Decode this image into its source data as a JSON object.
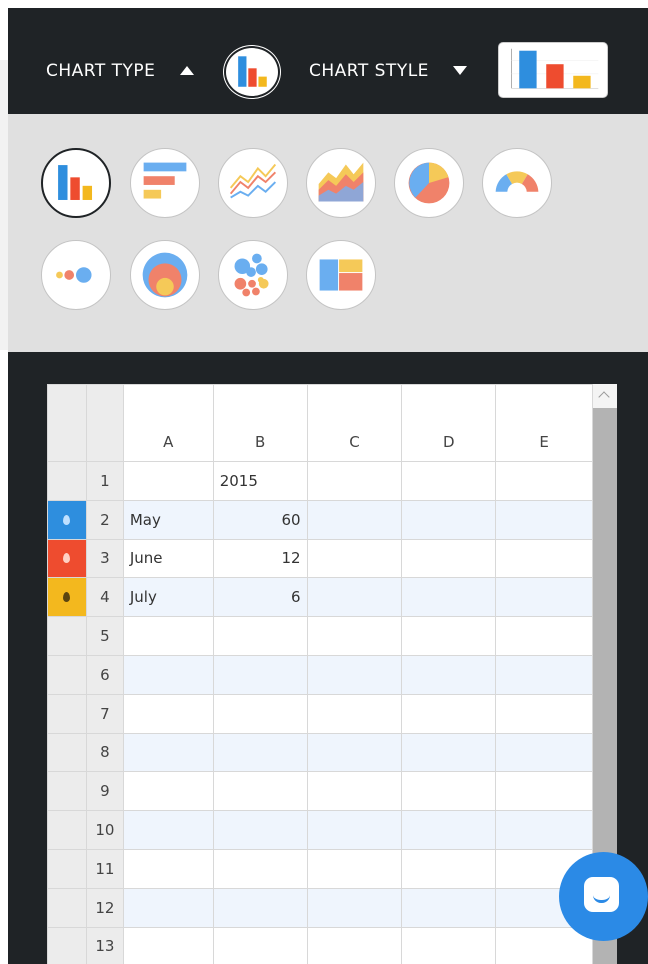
{
  "toolbar": {
    "chart_type_label": "CHART TYPE",
    "chart_style_label": "CHART STYLE",
    "chart_type_state": "expanded",
    "chart_style_state": "collapsed"
  },
  "chart_types": [
    {
      "name": "column-chart",
      "selected": true
    },
    {
      "name": "bar-chart",
      "selected": false
    },
    {
      "name": "line-chart",
      "selected": false
    },
    {
      "name": "area-chart",
      "selected": false
    },
    {
      "name": "pie-chart",
      "selected": false
    },
    {
      "name": "gauge-chart",
      "selected": false
    },
    {
      "name": "dot-chart",
      "selected": false
    },
    {
      "name": "nested-circles-chart",
      "selected": false
    },
    {
      "name": "bubble-chart",
      "selected": false
    },
    {
      "name": "treemap-chart",
      "selected": false
    }
  ],
  "colors": {
    "blue": "#2e8ede",
    "red": "#ee4c2f",
    "yellow": "#f3b81e",
    "dark_bg": "#1f2326",
    "panel_bg": "#e0e0e0",
    "chat": "#2b8ae6"
  },
  "grid": {
    "columns": [
      "A",
      "B",
      "C",
      "D",
      "E"
    ],
    "rows": [
      {
        "num": "1",
        "swatch": "",
        "A": "",
        "B": "2015",
        "C": "",
        "D": "",
        "E": ""
      },
      {
        "num": "2",
        "swatch": "blue",
        "A": "May",
        "B": "60",
        "C": "",
        "D": "",
        "E": ""
      },
      {
        "num": "3",
        "swatch": "red",
        "A": "June",
        "B": "12",
        "C": "",
        "D": "",
        "E": ""
      },
      {
        "num": "4",
        "swatch": "yellow",
        "A": "July",
        "B": "6",
        "C": "",
        "D": "",
        "E": ""
      },
      {
        "num": "5",
        "swatch": "",
        "A": "",
        "B": "",
        "C": "",
        "D": "",
        "E": ""
      },
      {
        "num": "6",
        "swatch": "",
        "A": "",
        "B": "",
        "C": "",
        "D": "",
        "E": ""
      },
      {
        "num": "7",
        "swatch": "",
        "A": "",
        "B": "",
        "C": "",
        "D": "",
        "E": ""
      },
      {
        "num": "8",
        "swatch": "",
        "A": "",
        "B": "",
        "C": "",
        "D": "",
        "E": ""
      },
      {
        "num": "9",
        "swatch": "",
        "A": "",
        "B": "",
        "C": "",
        "D": "",
        "E": ""
      },
      {
        "num": "10",
        "swatch": "",
        "A": "",
        "B": "",
        "C": "",
        "D": "",
        "E": ""
      },
      {
        "num": "11",
        "swatch": "",
        "A": "",
        "B": "",
        "C": "",
        "D": "",
        "E": ""
      },
      {
        "num": "12",
        "swatch": "",
        "A": "",
        "B": "",
        "C": "",
        "D": "",
        "E": ""
      },
      {
        "num": "13",
        "swatch": "",
        "A": "",
        "B": "",
        "C": "",
        "D": "",
        "E": ""
      }
    ]
  },
  "chat": {
    "icon": "chat-icon"
  }
}
